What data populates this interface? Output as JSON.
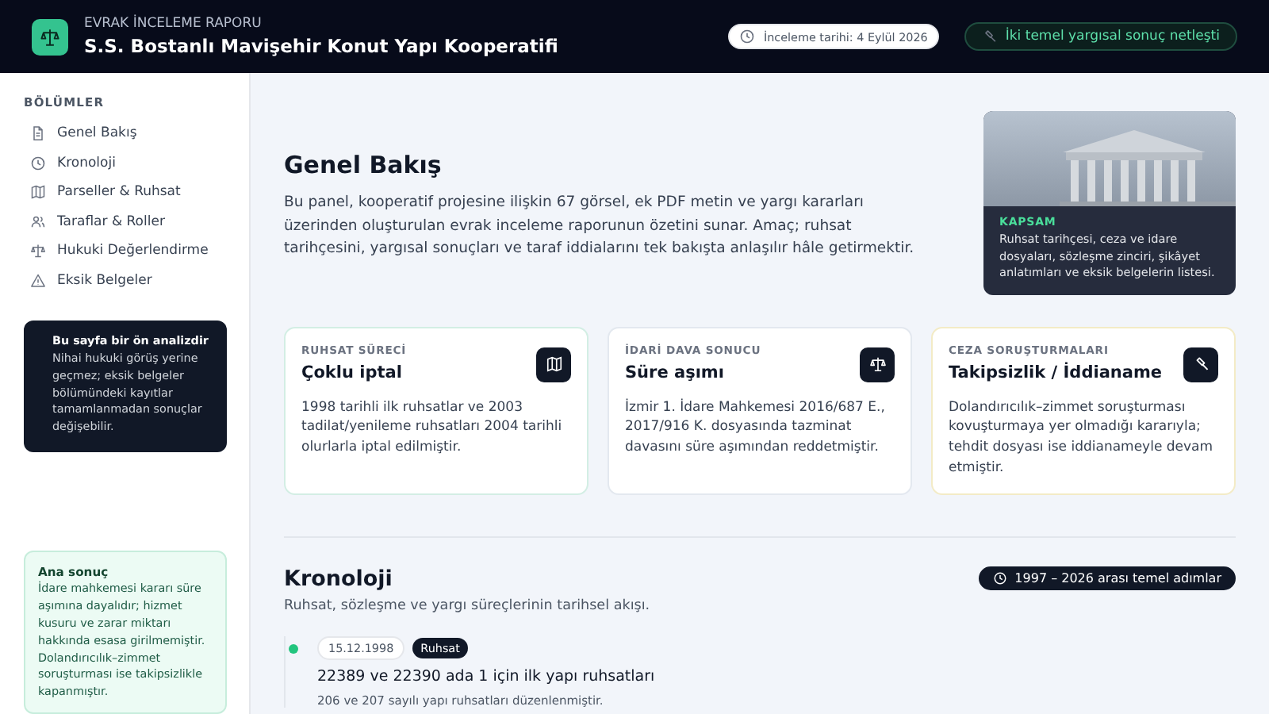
{
  "header": {
    "kicker": "EVRAK İNCELEME RAPORU",
    "title": "S.S. Bostanlı Mavişehir Konut Yapı Kooperatifi",
    "badges": [
      {
        "kind": "date",
        "label": "İnceleme tarihi: 4 Eylül 2026"
      },
      {
        "kind": "result",
        "label": "İki temel yargısal sonuç netleşti"
      }
    ]
  },
  "sidebar": {
    "heading": "BÖLÜMLER",
    "items": [
      {
        "label": "Genel Bakış",
        "selected": false
      },
      {
        "label": "Kronoloji",
        "selected": false
      },
      {
        "label": "Parseller & Ruhsat",
        "selected": false
      },
      {
        "label": "Taraflar & Roller",
        "selected": false
      },
      {
        "label": "Hukuki Değerlendirme",
        "selected": false
      },
      {
        "label": "Eksik Belgeler",
        "selected": false
      }
    ],
    "notice": {
      "title": "Bu sayfa bir ön analizdir",
      "text": "Nihai hukuki görüş yerine geçmez; eksik belgeler bölümündeki kayıtlar tamamlanmadan sonuçlar değişebilir."
    },
    "conclusion": {
      "title": "Ana sonuç",
      "text": "İdare mahkemesi kararı süre aşımına dayalıdır; hizmet kusuru ve zarar miktarı hakkında esasa girilmemiştir. Dolandırıcılık–zimmet soruşturması ise takipsizlikle kapanmıştır."
    }
  },
  "overview": {
    "title": "Genel Bakış",
    "text": "Bu panel, kooperatif projesine ilişkin 67 görsel, ek PDF metin ve yargı kararları üzerinden oluşturulan evrak inceleme raporunun özetini sunar. Amaç; ruhsat tarihçesini, yargısal sonuçları ve taraf iddialarını tek bakışta anlaşılır hâle getirmektir.",
    "scope": {
      "label": "KAPSAM",
      "text": "Ruhsat tarihçesi, ceza ve idare dosyaları, sözleşme zinciri, şikâyet anlatımları ve eksik belgelerin listesi."
    }
  },
  "cards": [
    {
      "color": "#d3eee4",
      "kicker": "RUHSAT SÜRECİ",
      "title": "Çoklu iptal",
      "text": "1998 tarihli ilk ruhsatlar ve 2003 tadilat/yenileme ruhsatları 2004 tarihli olurlarla iptal edilmiştir."
    },
    {
      "color": "#e3e8ef",
      "kicker": "İDARİ DAVA SONUCU",
      "title": "Süre aşımı",
      "text": "İzmir 1. İdare Mahkemesi 2016/687 E., 2017/916 K. dosyasında tazminat davasını süre aşımından reddetmiştir."
    },
    {
      "color": "#f3ebc6",
      "kicker": "CEZA SORUŞTURMALARI",
      "title": "Takipsizlik / İddianame",
      "text": "Dolandırıcılık–zimmet soruşturması kovuşturmaya yer olmadığı kararıyla; tehdit dosyası ise iddianameyle devam etmiştir."
    }
  ],
  "chronology": {
    "title": "Kronoloji",
    "subtitle": "Ruhsat, sözleşme ve yargı süreçlerinin tarihsel akışı.",
    "range": "1997 – 2026 arası temel adımlar",
    "events": [
      {
        "date": "15.12.1998",
        "tag": "Ruhsat",
        "title": "22389 ve 22390 ada 1 için ilk yapı ruhsatları",
        "text": "206 ve 207 sayılı yapı ruhsatları düzenlenmiştir."
      }
    ]
  }
}
